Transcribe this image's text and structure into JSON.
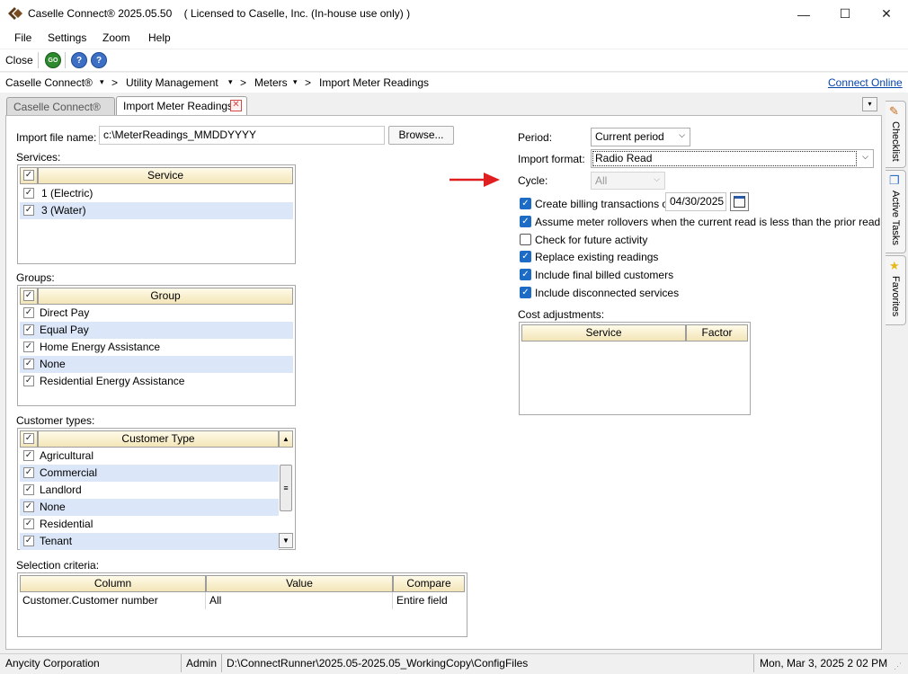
{
  "window": {
    "title": "Caselle Connect® 2025.05.50",
    "license": "( Licensed to Caselle, Inc. (In-house use only) )",
    "controls": [
      "—",
      "☐",
      "✕"
    ]
  },
  "menu": [
    "File",
    "Settings",
    "Zoom",
    "Help"
  ],
  "toolbar": {
    "close_label": "Close",
    "go_label": "GO",
    "help_label": "?",
    "help2_label": "?"
  },
  "breadcrumb": {
    "items": [
      "Caselle Connect®",
      "Utility Management",
      "Meters",
      "Import Meter Readings"
    ],
    "separator": ">",
    "dropdown": "▾",
    "connect_online": "Connect Online"
  },
  "tabs": [
    {
      "label": "Caselle Connect®"
    },
    {
      "label": "Import Meter Readings",
      "close": "✕"
    }
  ],
  "tab_dropdown": "▾",
  "form": {
    "import_file_label": "Import file name:",
    "import_file_value": "c:\\MeterReadings_MMDDYYYY",
    "browse_label": "Browse...",
    "services_label": "Services:",
    "services_header": "Service",
    "services": [
      "1 (Electric)",
      "3 (Water)"
    ],
    "groups_label": "Groups:",
    "groups_header": "Group",
    "groups": [
      "Direct Pay",
      "Equal Pay",
      "Home Energy Assistance",
      "None",
      "Residential Energy Assistance"
    ],
    "customer_types_label": "Customer types:",
    "customer_types_header": "Customer Type",
    "customer_types": [
      "Agricultural",
      "Commercial",
      "Landlord",
      "None",
      "Residential",
      "Tenant"
    ],
    "selection_label": "Selection criteria:",
    "selection_headers": [
      "Column",
      "Value",
      "Compare"
    ],
    "selection_rows": [
      [
        "Customer.Customer number",
        "All",
        "Entire field"
      ]
    ],
    "period_label": "Period:",
    "period_value": "Current period",
    "import_format_label": "Import format:",
    "import_format_value": "Radio Read",
    "cycle_label": "Cycle:",
    "cycle_value": "All",
    "options": [
      {
        "label": "Create billing transactions on",
        "checked": true
      },
      {
        "label": "Assume meter rollovers when the current read is less than the prior read",
        "checked": true
      },
      {
        "label": "Check for future activity",
        "checked": false
      },
      {
        "label": "Replace existing readings",
        "checked": true
      },
      {
        "label": "Include final billed customers",
        "checked": true
      },
      {
        "label": "Include disconnected services",
        "checked": true
      }
    ],
    "billing_date": "04/30/2025",
    "cost_adj_label": "Cost adjustments:",
    "cost_adj_headers": [
      "Service",
      "Factor"
    ]
  },
  "side_panel": [
    "Checklist",
    "Active Tasks",
    "Favorites"
  ],
  "status": {
    "org": "Anycity Corporation",
    "user": "Admin",
    "path": "D:\\ConnectRunner\\2025.05-2025.05_WorkingCopy\\ConfigFiles",
    "datetime": "Mon, Mar 3, 2025 2 02 PM"
  },
  "colors": {
    "selection_row": "#dbe6f8",
    "checkbox_blue": "#1c6bc4",
    "arrow": "#e02020",
    "header": "#f3e5b8"
  }
}
